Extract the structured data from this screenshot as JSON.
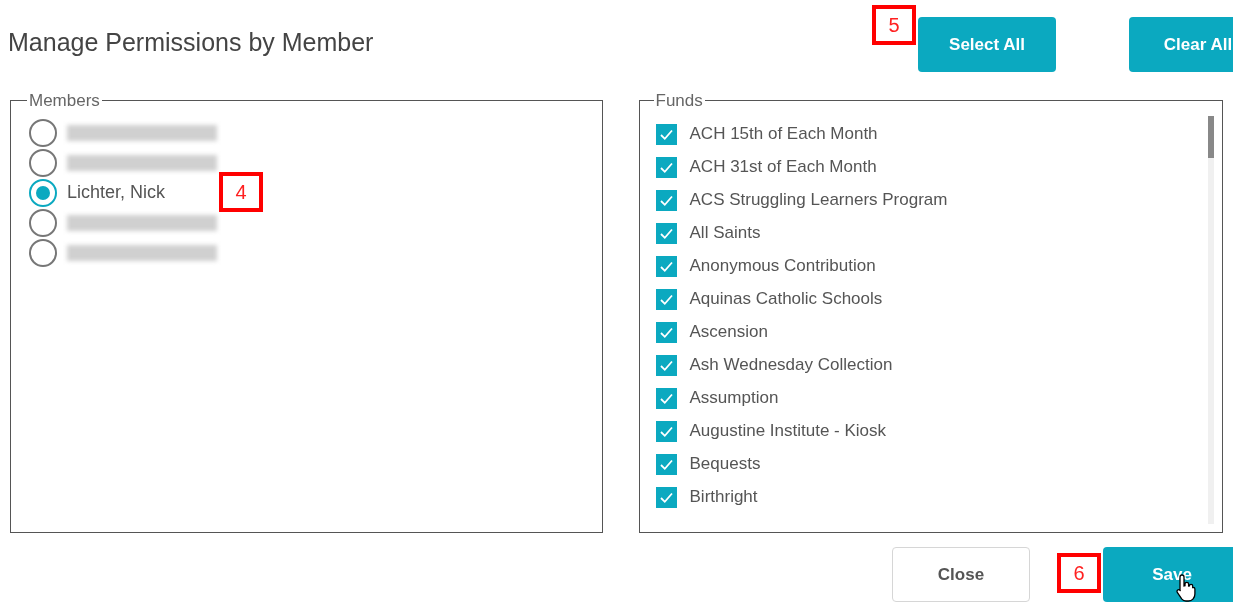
{
  "title": "Manage Permissions by Member",
  "top_buttons": [
    {
      "label": "Select All"
    },
    {
      "label": "Clear All"
    }
  ],
  "members": {
    "legend": "Members",
    "items": [
      {
        "redacted": true,
        "selected": false
      },
      {
        "redacted": true,
        "selected": false
      },
      {
        "redacted": false,
        "name": "Lichter, Nick",
        "selected": true
      },
      {
        "redacted": true,
        "selected": false
      },
      {
        "redacted": true,
        "selected": false
      }
    ]
  },
  "funds": {
    "legend": "Funds",
    "items": [
      {
        "label": "ACH 15th of Each Month",
        "checked": true
      },
      {
        "label": "ACH 31st of Each Month",
        "checked": true
      },
      {
        "label": "ACS Struggling Learners Program",
        "checked": true
      },
      {
        "label": "All Saints",
        "checked": true
      },
      {
        "label": "Anonymous Contribution",
        "checked": true
      },
      {
        "label": "Aquinas Catholic Schools",
        "checked": true
      },
      {
        "label": "Ascension",
        "checked": true
      },
      {
        "label": "Ash Wednesday Collection",
        "checked": true
      },
      {
        "label": "Assumption",
        "checked": true
      },
      {
        "label": "Augustine Institute - Kiosk",
        "checked": true
      },
      {
        "label": "Bequests",
        "checked": true
      },
      {
        "label": "Birthright",
        "checked": true
      }
    ]
  },
  "bottom_buttons": [
    {
      "label": "Close",
      "kind": "outline"
    },
    {
      "label": "Save",
      "kind": "primary"
    }
  ],
  "callouts": [
    {
      "label": "4"
    },
    {
      "label": "5"
    },
    {
      "label": "6"
    }
  ]
}
